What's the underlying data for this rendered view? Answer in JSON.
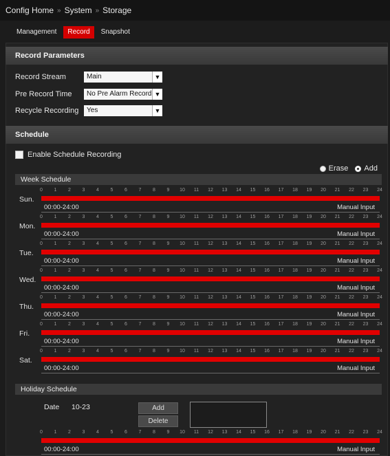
{
  "breadcrumb": {
    "items": [
      "Config Home",
      "System",
      "Storage"
    ],
    "separator": "»"
  },
  "tabs": [
    {
      "label": "Management",
      "active": false
    },
    {
      "label": "Record",
      "active": true
    },
    {
      "label": "Snapshot",
      "active": false
    }
  ],
  "record_params": {
    "title": "Record Parameters",
    "fields": [
      {
        "label": "Record Stream",
        "value": "Main"
      },
      {
        "label": "Pre Record Time",
        "value": "No Pre Alarm Record"
      },
      {
        "label": "Recycle Recording",
        "value": "Yes"
      }
    ]
  },
  "schedule": {
    "title": "Schedule",
    "enable_label": "Enable Schedule Recording",
    "enabled": false,
    "mode": {
      "erase": "Erase",
      "add": "Add",
      "selected": "add"
    },
    "week_title": "Week Schedule",
    "hours": [
      "0",
      "1",
      "2",
      "3",
      "4",
      "5",
      "6",
      "7",
      "8",
      "9",
      "10",
      "11",
      "12",
      "13",
      "14",
      "15",
      "16",
      "17",
      "18",
      "19",
      "20",
      "21",
      "22",
      "23",
      "24"
    ],
    "days": [
      {
        "label": "Sun.",
        "range": "00:00-24:00",
        "manual": "Manual Input"
      },
      {
        "label": "Mon.",
        "range": "00:00-24:00",
        "manual": "Manual Input"
      },
      {
        "label": "Tue.",
        "range": "00:00-24:00",
        "manual": "Manual Input"
      },
      {
        "label": "Wed.",
        "range": "00:00-24:00",
        "manual": "Manual Input"
      },
      {
        "label": "Thu.",
        "range": "00:00-24:00",
        "manual": "Manual Input"
      },
      {
        "label": "Fri.",
        "range": "00:00-24:00",
        "manual": "Manual Input"
      },
      {
        "label": "Sat.",
        "range": "00:00-24:00",
        "manual": "Manual Input"
      }
    ],
    "holiday": {
      "title": "Holiday Schedule",
      "date_label": "Date",
      "date_value": "10-23",
      "add_label": "Add",
      "delete_label": "Delete",
      "range": "00:00-24:00",
      "manual": "Manual Input"
    }
  },
  "colors": {
    "accent": "#d40000",
    "bar": "#e10000",
    "background": "#1c1c1c"
  }
}
